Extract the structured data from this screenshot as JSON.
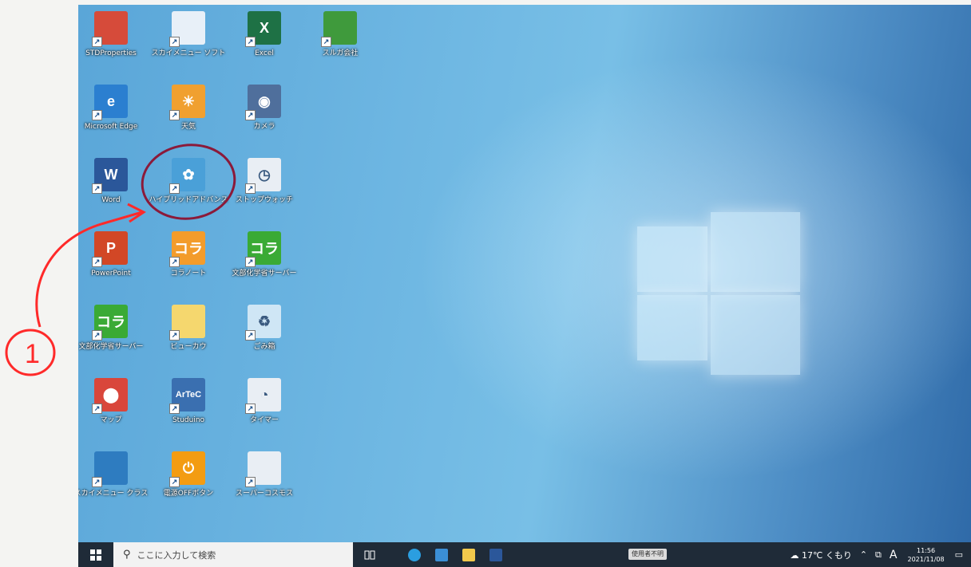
{
  "desktop": {
    "icons": [
      {
        "label": "STDProperties",
        "icon": "stdproperties-icon",
        "color": "#d64b3a",
        "text": ""
      },
      {
        "label": "スカイメニュー ソフト",
        "icon": "sky-menu-soft-icon",
        "color": "#e8f0f8",
        "text": ""
      },
      {
        "label": "Excel",
        "icon": "excel-icon",
        "color": "#1e7145",
        "text": "X"
      },
      {
        "label": "スルガ会社",
        "icon": "folder-app-icon",
        "color": "#3f9a3c",
        "text": ""
      },
      {
        "label": "Microsoft Edge",
        "icon": "edge-icon",
        "color": "#2b7fd0",
        "text": "e"
      },
      {
        "label": "天気",
        "icon": "weather-icon",
        "color": "#f0a030",
        "text": "☀"
      },
      {
        "label": "カメラ",
        "icon": "camera-icon",
        "color": "#4f6f9c",
        "text": "◉"
      },
      {
        "label": "Word",
        "icon": "word-icon",
        "color": "#2b579a",
        "text": "W"
      },
      {
        "label": "ハイブリッドアドバンス",
        "icon": "hybrid-advance-icon",
        "color": "#4aa0d8",
        "text": "✿"
      },
      {
        "label": "ストップウォッチ",
        "icon": "stopwatch-icon",
        "color": "#e9eef4",
        "text": "◷"
      },
      {
        "label": "PowerPoint",
        "icon": "powerpoint-icon",
        "color": "#d24726",
        "text": "P"
      },
      {
        "label": "コラノート",
        "icon": "kora-note-icon",
        "color": "#f39c2b",
        "text": "コラ"
      },
      {
        "label": "文部化学省サーバー",
        "icon": "kora-server-icon",
        "color": "#3aaa35",
        "text": "コラ"
      },
      {
        "label": "文部化学省サーバー",
        "icon": "kora-server-2-icon",
        "color": "#3aaa35",
        "text": "コラ"
      },
      {
        "label": "ビューカウ",
        "icon": "file-icon",
        "color": "#f5d76e",
        "text": ""
      },
      {
        "label": "ごみ箱",
        "icon": "recycle-bin-icon",
        "color": "#cfe6f5",
        "text": "♻"
      },
      {
        "label": "マップ",
        "icon": "maps-icon",
        "color": "#d9463b",
        "text": "⬤"
      },
      {
        "label": "Studuino",
        "icon": "artec-icon",
        "color": "#3a6fb0",
        "text": "ArTeC"
      },
      {
        "label": "タイマー",
        "icon": "timer-icon",
        "color": "#e9eef4",
        "text": "◔"
      },
      {
        "label": "スカイメニュー クラス",
        "icon": "sky-menu-class-icon",
        "color": "#2e7cc0",
        "text": ""
      },
      {
        "label": "電源OFFボタン",
        "icon": "power-off-icon",
        "color": "#f39c12",
        "text": "⏻"
      },
      {
        "label": "スーパーコスモス",
        "icon": "network-icon",
        "color": "#e9eef4",
        "text": ""
      }
    ]
  },
  "annotation": {
    "number_label": "1",
    "stroke_color": "#ff2a2a",
    "circle_color": "#8b1a3a"
  },
  "taskbar": {
    "search_placeholder": "ここに入力して検索",
    "status_pill": "使用者不明",
    "weather": "17℃ くもり",
    "ime": "A",
    "time": "11:56",
    "date": "2021/11/08"
  },
  "colors": {
    "taskbar": "#1f2b38",
    "desktop_accent": "#5aa6d8"
  }
}
